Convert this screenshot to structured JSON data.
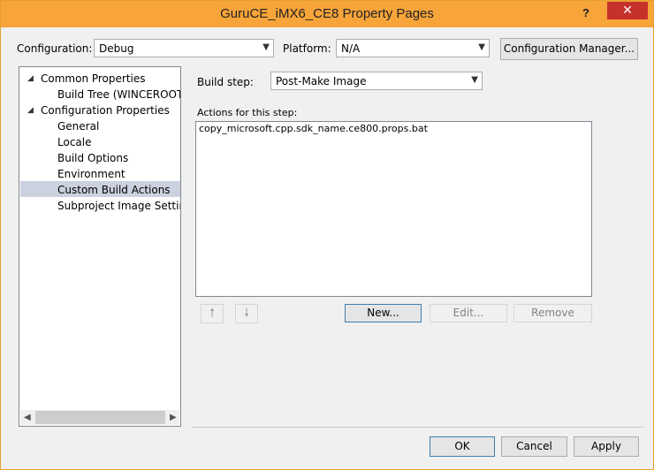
{
  "window": {
    "title": "GuruCE_iMX6_CE8 Property Pages",
    "help_label": "?",
    "close_label": "✕"
  },
  "config": {
    "label": "Configuration:",
    "value": "Debug"
  },
  "platform": {
    "label": "Platform:",
    "value": "N/A"
  },
  "config_manager_label": "Configuration Manager...",
  "tree": {
    "items": [
      {
        "label": "Common Properties"
      },
      {
        "label": "Build Tree (WINCEROOT)"
      },
      {
        "label": "Configuration Properties"
      },
      {
        "label": "General"
      },
      {
        "label": "Locale"
      },
      {
        "label": "Build Options"
      },
      {
        "label": "Environment"
      },
      {
        "label": "Custom Build Actions"
      },
      {
        "label": "Subproject Image Settings"
      }
    ],
    "selected": "Custom Build Actions"
  },
  "build_step": {
    "label": "Build step:",
    "value": "Post-Make Image"
  },
  "actions": {
    "label": "Actions for this step:",
    "items": [
      "copy_microsoft.cpp.sdk_name.ce800.props.bat"
    ]
  },
  "buttons": {
    "new": "New...",
    "edit": "Edit...",
    "remove": "Remove",
    "ok": "OK",
    "cancel": "Cancel",
    "apply": "Apply"
  },
  "icons": {
    "up": "arrow-up-icon",
    "down": "arrow-down-icon"
  },
  "colors": {
    "title_bar": "#f7a43a",
    "close": "#c7312b",
    "selection": "#ccd1e0",
    "dialog_bg": "#f0f0f0"
  }
}
